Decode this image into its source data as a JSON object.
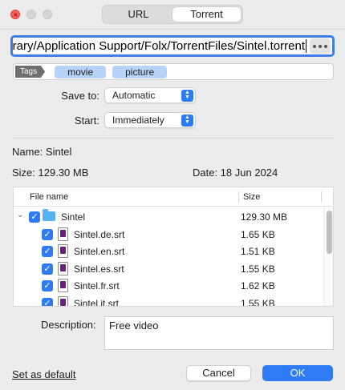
{
  "tabs": [
    {
      "label": "URL",
      "active": false
    },
    {
      "label": "Torrent",
      "active": true
    }
  ],
  "path_field": {
    "value": "orary/Application Support/Folx/TorrentFiles/Sintel.torrent"
  },
  "tags": {
    "label": "Tags",
    "items": [
      "movie",
      "picture"
    ]
  },
  "save_to": {
    "label": "Save to:",
    "value": "Automatic"
  },
  "start": {
    "label": "Start:",
    "value": "Immediately"
  },
  "info": {
    "name": "Name:  Sintel",
    "size": "Size:  129.30 MB",
    "date": "Date:  18 Jun 2024"
  },
  "table": {
    "columns": [
      "File name",
      "Size"
    ],
    "rows": [
      {
        "name": "Sintel",
        "size": "129.30 MB",
        "type": "folder",
        "checked": true
      },
      {
        "name": "Sintel.de.srt",
        "size": "1.65 KB",
        "type": "file",
        "checked": true
      },
      {
        "name": "Sintel.en.srt",
        "size": "1.51 KB",
        "type": "file",
        "checked": true
      },
      {
        "name": "Sintel.es.srt",
        "size": "1.55 KB",
        "type": "file",
        "checked": true
      },
      {
        "name": "Sintel.fr.srt",
        "size": "1.62 KB",
        "type": "file",
        "checked": true
      },
      {
        "name": "Sintel.it.srt",
        "size": "1.55 KB",
        "type": "file",
        "checked": true
      }
    ]
  },
  "description": {
    "label": "Description:",
    "value": "Free video"
  },
  "footer": {
    "set_default": "Set as default",
    "cancel": "Cancel",
    "ok": "OK"
  },
  "colors": {
    "accent": "#2f7bf5",
    "tag_bg": "#b7d3f7",
    "folder": "#56b2f1"
  },
  "icons": {
    "more": "ellipsis-icon",
    "check": "checkmark-icon",
    "folder": "folder-icon",
    "file": "subtitle-file-icon",
    "popup": "chevron-updown-icon",
    "disclosure": "chevron-down-icon"
  }
}
